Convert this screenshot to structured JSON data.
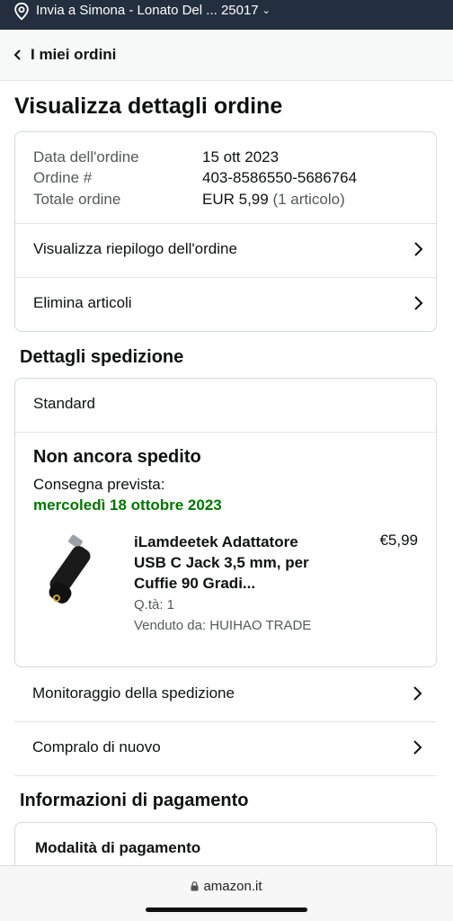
{
  "topbar": {
    "location": "Invia a Simona - Lonato Del ... 25017"
  },
  "header": {
    "title": "I miei ordini"
  },
  "page_title": "Visualizza dettagli ordine",
  "order": {
    "date_label": "Data dell'ordine",
    "date_value": "15 ott 2023",
    "number_label": "Ordine #",
    "number_value": "403-8586550-5686764",
    "total_label": "Totale ordine",
    "total_value": "EUR 5,99",
    "total_items": "(1 articolo)",
    "summary_link": "Visualizza riepilogo dell'ordine",
    "remove_link": "Elimina articoli"
  },
  "shipping": {
    "section_title": "Dettagli spedizione",
    "method": "Standard",
    "status": "Non ancora spedito",
    "eta_label": "Consegna prevista:",
    "eta_date": "mercoledì 18 ottobre 2023",
    "product": {
      "title": "iLamdeetek Adattatore USB C Jack 3,5 mm, per Cuffie 90 Gradi...",
      "price": "€5,99",
      "qty": "Q.tà: 1",
      "seller": "Venduto da: HUIHAO TRADE"
    }
  },
  "actions": {
    "track": "Monitoraggio della spedizione",
    "buy_again": "Compralo di nuovo"
  },
  "payment": {
    "section_title": "Informazioni di pagamento",
    "method_label": "Modalità di pagamento"
  },
  "browser": {
    "url": "amazon.it"
  },
  "colors": {
    "topbar": "#232f3e",
    "green": "#007600"
  }
}
